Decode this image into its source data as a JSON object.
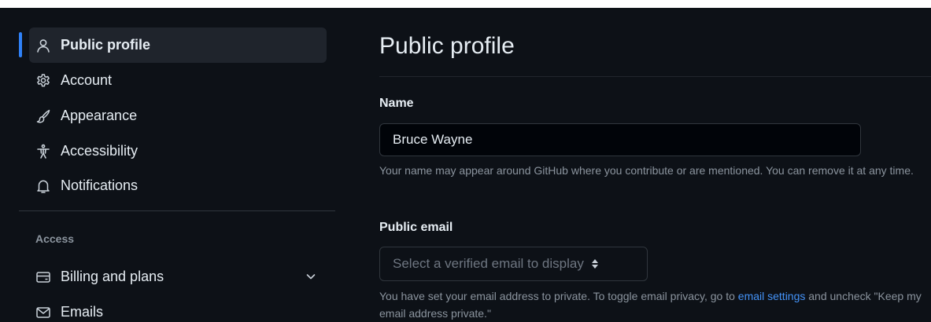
{
  "sidebar": {
    "items": [
      {
        "label": "Public profile",
        "icon": "person-icon",
        "active": true
      },
      {
        "label": "Account",
        "icon": "gear-icon"
      },
      {
        "label": "Appearance",
        "icon": "paintbrush-icon"
      },
      {
        "label": "Accessibility",
        "icon": "accessibility-icon"
      },
      {
        "label": "Notifications",
        "icon": "bell-icon"
      }
    ],
    "section_access": "Access",
    "access_items": [
      {
        "label": "Billing and plans",
        "icon": "credit-card-icon",
        "expandable": true
      },
      {
        "label": "Emails",
        "icon": "mail-icon"
      }
    ]
  },
  "main": {
    "title": "Public profile",
    "name_field": {
      "label": "Name",
      "value": "Bruce Wayne",
      "note": "Your name may appear around GitHub where you contribute or are mentioned. You can remove it at any time."
    },
    "email_field": {
      "label": "Public email",
      "selected": "Select a verified email to display",
      "note_before": "You have set your email address to private. To toggle email privacy, go to ",
      "note_link": "email settings",
      "note_after": " and uncheck \"Keep my email address private.\""
    }
  },
  "colors": {
    "background": "#0d1117",
    "accent": "#2f81f7",
    "link": "#4493f8",
    "muted_text": "#8b949e"
  }
}
